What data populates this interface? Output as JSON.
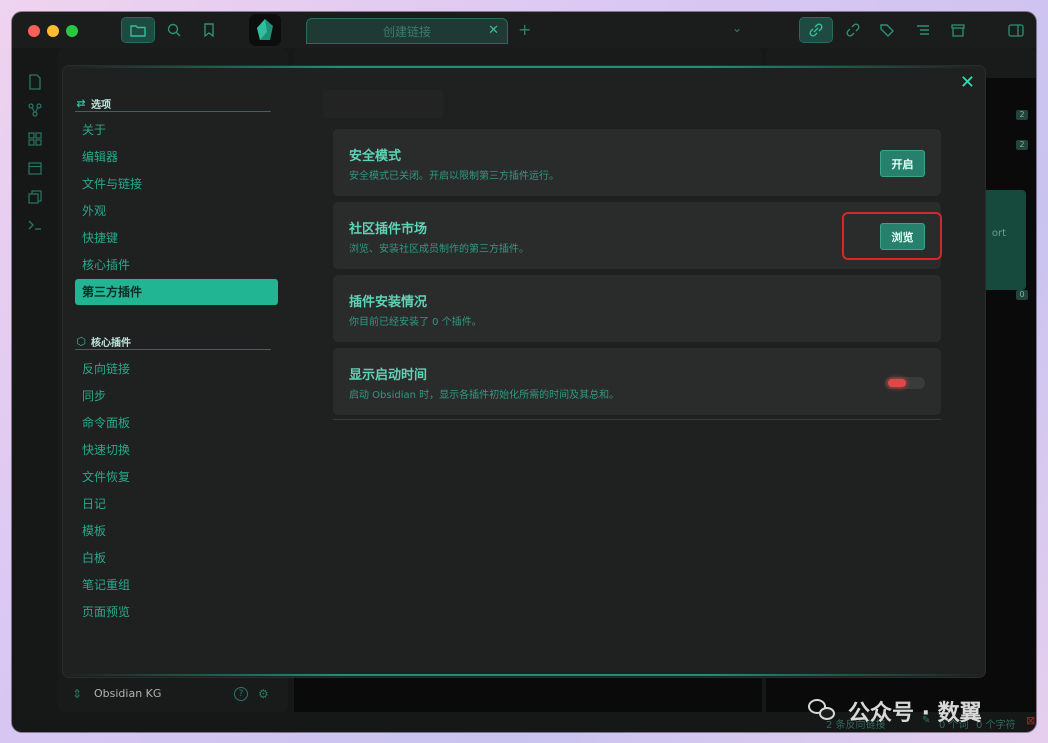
{
  "window": {
    "tab_title": "创建链接",
    "tab_close": "✕",
    "new_tab": "+",
    "tab_list_chevron": "⌄"
  },
  "titlebar_icons": [
    "folder-icon",
    "search-icon",
    "bookmark-icon",
    "link-icon",
    "unlinked-icon",
    "tags-icon",
    "outline-icon",
    "archive-icon",
    "sidebar-toggle-icon"
  ],
  "ribbon_icons": [
    "file-icon",
    "graph-icon",
    "grid-icon",
    "calendar-icon",
    "copy-icon",
    "terminal-icon"
  ],
  "vault": {
    "name": "Obsidian KG",
    "help": "?",
    "settings": "⚙"
  },
  "right_pane": {
    "badges": [
      "2",
      "2",
      "0"
    ],
    "card_text": "ort"
  },
  "statusbar": {
    "backlinks": "2 条反向链接",
    "words": "0 个词",
    "chars": "0 个字符"
  },
  "modal": {
    "close": "✕",
    "options_header": "选项",
    "options_items": [
      "关于",
      "编辑器",
      "文件与链接",
      "外观",
      "快捷键",
      "核心插件",
      "第三方插件"
    ],
    "active_item": "第三方插件",
    "core_header": "核心插件",
    "core_items": [
      "反向链接",
      "同步",
      "命令面板",
      "快速切换",
      "文件恢复",
      "日记",
      "模板",
      "白板",
      "笔记重组",
      "页面预览"
    ],
    "settings": [
      {
        "name": "安全模式",
        "desc": "安全模式已关闭。开启以限制第三方插件运行。",
        "button": "开启"
      },
      {
        "name": "社区插件市场",
        "desc": "浏览、安装社区成员制作的第三方插件。",
        "button": "浏览"
      },
      {
        "name": "插件安装情况",
        "desc": "你目前已经安装了 0 个插件。"
      },
      {
        "name": "显示启动时间",
        "desc": "启动 Obsidian 时，显示各插件初始化所需的时间及其总和。",
        "toggle_on": false
      }
    ]
  },
  "watermark": {
    "text": "公众号 · 数翼"
  },
  "colors": {
    "accent": "#22b594",
    "background": "#1f2020",
    "highlight_box": "#d4272a"
  }
}
